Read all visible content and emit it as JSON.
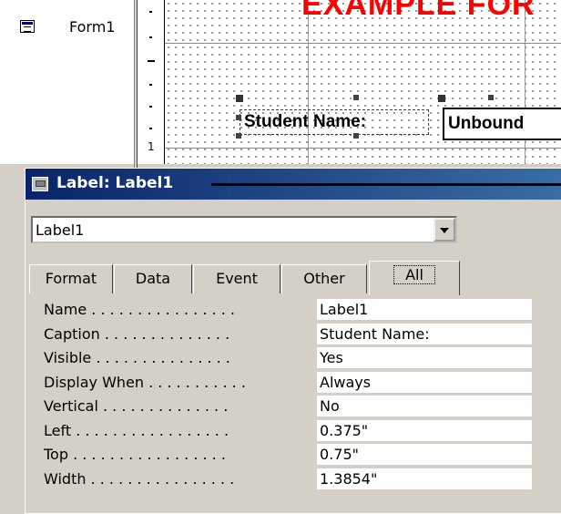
{
  "nav": {
    "form_item": "Form1"
  },
  "ruler": {
    "number": "1"
  },
  "design": {
    "header_text": "EXAMPLE FOR",
    "label_caption": "Student Name:",
    "textbox_value": "Unbound"
  },
  "properties": {
    "title": "Label: Label1",
    "selector_value": "Label1",
    "tabs": [
      "Format",
      "Data",
      "Event",
      "Other",
      "All"
    ],
    "active_tab": "All",
    "rows": [
      {
        "name": "Name . . . . . . . . . . . . . . . .",
        "value": "Label1"
      },
      {
        "name": "Caption . . . . . . . . . . . . . .",
        "value": "Student Name:"
      },
      {
        "name": "Visible . . . . . . . . . . . . . . .",
        "value": "Yes"
      },
      {
        "name": "Display When . . . . . . . . . . .",
        "value": "Always"
      },
      {
        "name": "Vertical . . . . . . . . . . . . . .",
        "value": "No"
      },
      {
        "name": "Left . . . . . . . . . . . . . . . . .",
        "value": "0.375\""
      },
      {
        "name": "Top . . . . . . . . . . . . . . . . .",
        "value": "0.75\""
      },
      {
        "name": "Width . . . . . . . . . . . . . . . .",
        "value": "1.3854\""
      }
    ]
  },
  "colors": {
    "title_start": "#0a246a",
    "title_end": "#3a6ea5",
    "header_red": "#ff0000",
    "chrome": "#d4d0c8"
  }
}
